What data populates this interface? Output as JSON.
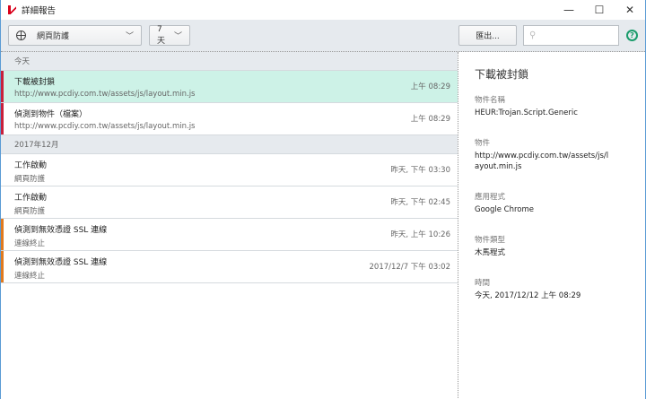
{
  "window": {
    "title": "詳細報告",
    "minimize": "—",
    "maximize": "☐",
    "close": "✕"
  },
  "toolbar": {
    "component": "網頁防護",
    "period": "7 天",
    "export_label": "匯出...",
    "search_placeholder": "",
    "help": "?"
  },
  "sections": [
    {
      "label": "今天",
      "rows": [
        {
          "title": "下載被封鎖",
          "subtitle": "http://www.pcdiy.com.tw/assets/js/layout.min.js",
          "time": "上午 08:29",
          "severity_color": "#c8203c",
          "selected": true
        },
        {
          "title": "偵測到物件（檔案）",
          "subtitle": "http://www.pcdiy.com.tw/assets/js/layout.min.js",
          "time": "上午 08:29",
          "severity_color": "#c8203c",
          "selected": false
        }
      ]
    },
    {
      "label": "2017年12月",
      "rows": [
        {
          "title": "工作啟動",
          "subtitle": "網頁防護",
          "time": "昨天, 下午 03:30",
          "severity_color": "",
          "selected": false
        },
        {
          "title": "工作啟動",
          "subtitle": "網頁防護",
          "time": "昨天, 下午 02:45",
          "severity_color": "",
          "selected": false
        },
        {
          "title": "偵測到無效憑證 SSL 連線",
          "subtitle": "連線終止",
          "time": "昨天, 上午 10:26",
          "severity_color": "#e07a1f",
          "selected": false
        },
        {
          "title": "偵測到無效憑證 SSL 連線",
          "subtitle": "連線終止",
          "time": "2017/12/7 下午 03:02",
          "severity_color": "#e07a1f",
          "selected": false
        }
      ]
    }
  ],
  "details": {
    "title": "下載被封鎖",
    "fields": [
      {
        "label": "物件名稱",
        "value": "HEUR:Trojan.Script.Generic"
      },
      {
        "label": "物件",
        "value": "http://www.pcdiy.com.tw/assets/js/layout.min.js"
      },
      {
        "label": "應用程式",
        "value": "Google Chrome"
      },
      {
        "label": "物件類型",
        "value": "木馬程式"
      },
      {
        "label": "時間",
        "value": "今天, 2017/12/12 上午 08:29"
      }
    ]
  }
}
